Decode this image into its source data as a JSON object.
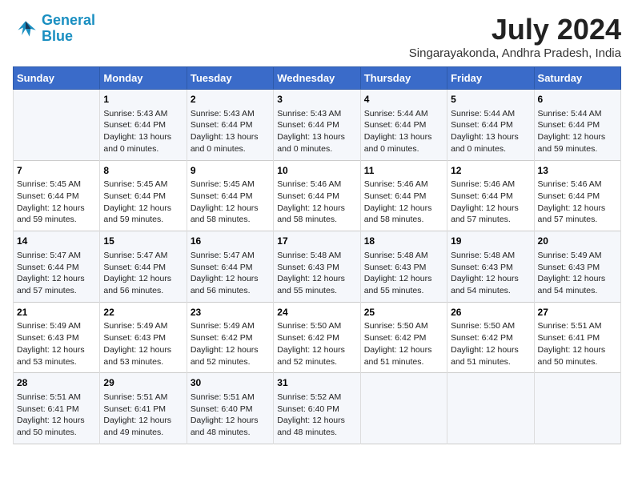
{
  "header": {
    "logo_line1": "General",
    "logo_line2": "Blue",
    "month_title": "July 2024",
    "location": "Singarayakonda, Andhra Pradesh, India"
  },
  "columns": [
    "Sunday",
    "Monday",
    "Tuesday",
    "Wednesday",
    "Thursday",
    "Friday",
    "Saturday"
  ],
  "weeks": [
    [
      {
        "day": "",
        "sunrise": "",
        "sunset": "",
        "daylight": ""
      },
      {
        "day": "1",
        "sunrise": "Sunrise: 5:43 AM",
        "sunset": "Sunset: 6:44 PM",
        "daylight": "Daylight: 13 hours and 0 minutes."
      },
      {
        "day": "2",
        "sunrise": "Sunrise: 5:43 AM",
        "sunset": "Sunset: 6:44 PM",
        "daylight": "Daylight: 13 hours and 0 minutes."
      },
      {
        "day": "3",
        "sunrise": "Sunrise: 5:43 AM",
        "sunset": "Sunset: 6:44 PM",
        "daylight": "Daylight: 13 hours and 0 minutes."
      },
      {
        "day": "4",
        "sunrise": "Sunrise: 5:44 AM",
        "sunset": "Sunset: 6:44 PM",
        "daylight": "Daylight: 13 hours and 0 minutes."
      },
      {
        "day": "5",
        "sunrise": "Sunrise: 5:44 AM",
        "sunset": "Sunset: 6:44 PM",
        "daylight": "Daylight: 13 hours and 0 minutes."
      },
      {
        "day": "6",
        "sunrise": "Sunrise: 5:44 AM",
        "sunset": "Sunset: 6:44 PM",
        "daylight": "Daylight: 12 hours and 59 minutes."
      }
    ],
    [
      {
        "day": "7",
        "sunrise": "Sunrise: 5:45 AM",
        "sunset": "Sunset: 6:44 PM",
        "daylight": "Daylight: 12 hours and 59 minutes."
      },
      {
        "day": "8",
        "sunrise": "Sunrise: 5:45 AM",
        "sunset": "Sunset: 6:44 PM",
        "daylight": "Daylight: 12 hours and 59 minutes."
      },
      {
        "day": "9",
        "sunrise": "Sunrise: 5:45 AM",
        "sunset": "Sunset: 6:44 PM",
        "daylight": "Daylight: 12 hours and 58 minutes."
      },
      {
        "day": "10",
        "sunrise": "Sunrise: 5:46 AM",
        "sunset": "Sunset: 6:44 PM",
        "daylight": "Daylight: 12 hours and 58 minutes."
      },
      {
        "day": "11",
        "sunrise": "Sunrise: 5:46 AM",
        "sunset": "Sunset: 6:44 PM",
        "daylight": "Daylight: 12 hours and 58 minutes."
      },
      {
        "day": "12",
        "sunrise": "Sunrise: 5:46 AM",
        "sunset": "Sunset: 6:44 PM",
        "daylight": "Daylight: 12 hours and 57 minutes."
      },
      {
        "day": "13",
        "sunrise": "Sunrise: 5:46 AM",
        "sunset": "Sunset: 6:44 PM",
        "daylight": "Daylight: 12 hours and 57 minutes."
      }
    ],
    [
      {
        "day": "14",
        "sunrise": "Sunrise: 5:47 AM",
        "sunset": "Sunset: 6:44 PM",
        "daylight": "Daylight: 12 hours and 57 minutes."
      },
      {
        "day": "15",
        "sunrise": "Sunrise: 5:47 AM",
        "sunset": "Sunset: 6:44 PM",
        "daylight": "Daylight: 12 hours and 56 minutes."
      },
      {
        "day": "16",
        "sunrise": "Sunrise: 5:47 AM",
        "sunset": "Sunset: 6:44 PM",
        "daylight": "Daylight: 12 hours and 56 minutes."
      },
      {
        "day": "17",
        "sunrise": "Sunrise: 5:48 AM",
        "sunset": "Sunset: 6:43 PM",
        "daylight": "Daylight: 12 hours and 55 minutes."
      },
      {
        "day": "18",
        "sunrise": "Sunrise: 5:48 AM",
        "sunset": "Sunset: 6:43 PM",
        "daylight": "Daylight: 12 hours and 55 minutes."
      },
      {
        "day": "19",
        "sunrise": "Sunrise: 5:48 AM",
        "sunset": "Sunset: 6:43 PM",
        "daylight": "Daylight: 12 hours and 54 minutes."
      },
      {
        "day": "20",
        "sunrise": "Sunrise: 5:49 AM",
        "sunset": "Sunset: 6:43 PM",
        "daylight": "Daylight: 12 hours and 54 minutes."
      }
    ],
    [
      {
        "day": "21",
        "sunrise": "Sunrise: 5:49 AM",
        "sunset": "Sunset: 6:43 PM",
        "daylight": "Daylight: 12 hours and 53 minutes."
      },
      {
        "day": "22",
        "sunrise": "Sunrise: 5:49 AM",
        "sunset": "Sunset: 6:43 PM",
        "daylight": "Daylight: 12 hours and 53 minutes."
      },
      {
        "day": "23",
        "sunrise": "Sunrise: 5:49 AM",
        "sunset": "Sunset: 6:42 PM",
        "daylight": "Daylight: 12 hours and 52 minutes."
      },
      {
        "day": "24",
        "sunrise": "Sunrise: 5:50 AM",
        "sunset": "Sunset: 6:42 PM",
        "daylight": "Daylight: 12 hours and 52 minutes."
      },
      {
        "day": "25",
        "sunrise": "Sunrise: 5:50 AM",
        "sunset": "Sunset: 6:42 PM",
        "daylight": "Daylight: 12 hours and 51 minutes."
      },
      {
        "day": "26",
        "sunrise": "Sunrise: 5:50 AM",
        "sunset": "Sunset: 6:42 PM",
        "daylight": "Daylight: 12 hours and 51 minutes."
      },
      {
        "day": "27",
        "sunrise": "Sunrise: 5:51 AM",
        "sunset": "Sunset: 6:41 PM",
        "daylight": "Daylight: 12 hours and 50 minutes."
      }
    ],
    [
      {
        "day": "28",
        "sunrise": "Sunrise: 5:51 AM",
        "sunset": "Sunset: 6:41 PM",
        "daylight": "Daylight: 12 hours and 50 minutes."
      },
      {
        "day": "29",
        "sunrise": "Sunrise: 5:51 AM",
        "sunset": "Sunset: 6:41 PM",
        "daylight": "Daylight: 12 hours and 49 minutes."
      },
      {
        "day": "30",
        "sunrise": "Sunrise: 5:51 AM",
        "sunset": "Sunset: 6:40 PM",
        "daylight": "Daylight: 12 hours and 48 minutes."
      },
      {
        "day": "31",
        "sunrise": "Sunrise: 5:52 AM",
        "sunset": "Sunset: 6:40 PM",
        "daylight": "Daylight: 12 hours and 48 minutes."
      },
      {
        "day": "",
        "sunrise": "",
        "sunset": "",
        "daylight": ""
      },
      {
        "day": "",
        "sunrise": "",
        "sunset": "",
        "daylight": ""
      },
      {
        "day": "",
        "sunrise": "",
        "sunset": "",
        "daylight": ""
      }
    ]
  ]
}
